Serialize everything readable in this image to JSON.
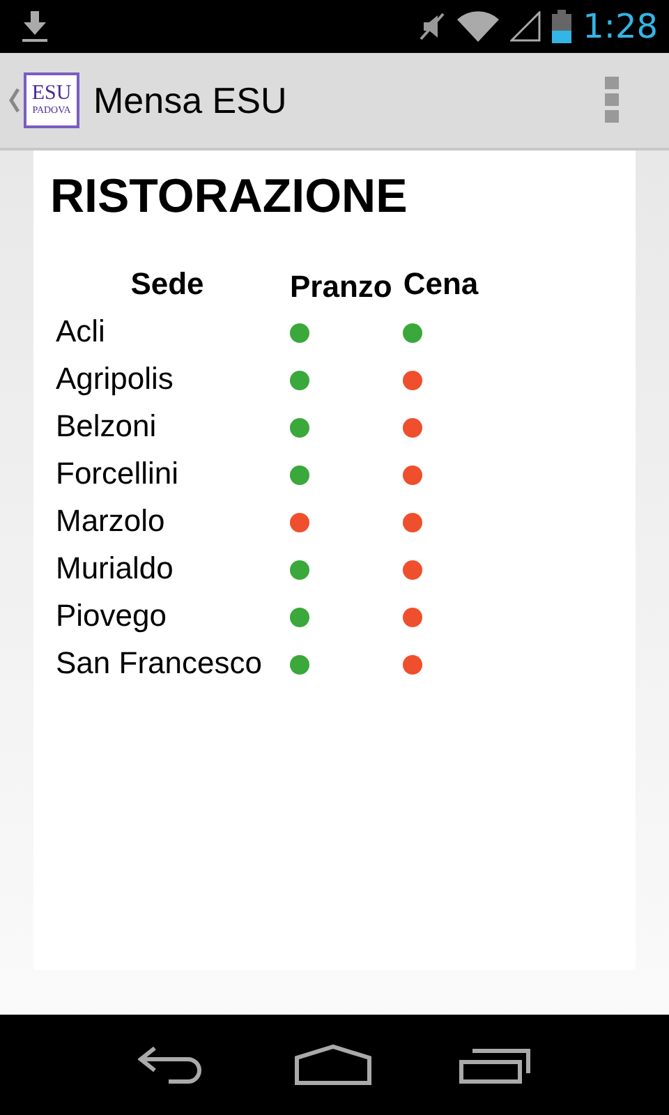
{
  "status_bar": {
    "time": "1:28"
  },
  "action_bar": {
    "logo": {
      "line1": "ESU",
      "line2": "PADOVA"
    },
    "title": "Mensa ESU"
  },
  "heading": "RISTORAZIONE",
  "table": {
    "columns": [
      "Sede",
      "Pranzo",
      "Cena"
    ],
    "rows": [
      {
        "sede": "Acli",
        "pranzo_open": true,
        "cena_open": true
      },
      {
        "sede": "Agripolis",
        "pranzo_open": true,
        "cena_open": false
      },
      {
        "sede": "Belzoni",
        "pranzo_open": true,
        "cena_open": false
      },
      {
        "sede": "Forcellini",
        "pranzo_open": true,
        "cena_open": false
      },
      {
        "sede": "Marzolo",
        "pranzo_open": false,
        "cena_open": false
      },
      {
        "sede": "Murialdo",
        "pranzo_open": true,
        "cena_open": false
      },
      {
        "sede": "Piovego",
        "pranzo_open": true,
        "cena_open": false
      },
      {
        "sede": "San Francesco",
        "pranzo_open": true,
        "cena_open": false
      }
    ]
  }
}
